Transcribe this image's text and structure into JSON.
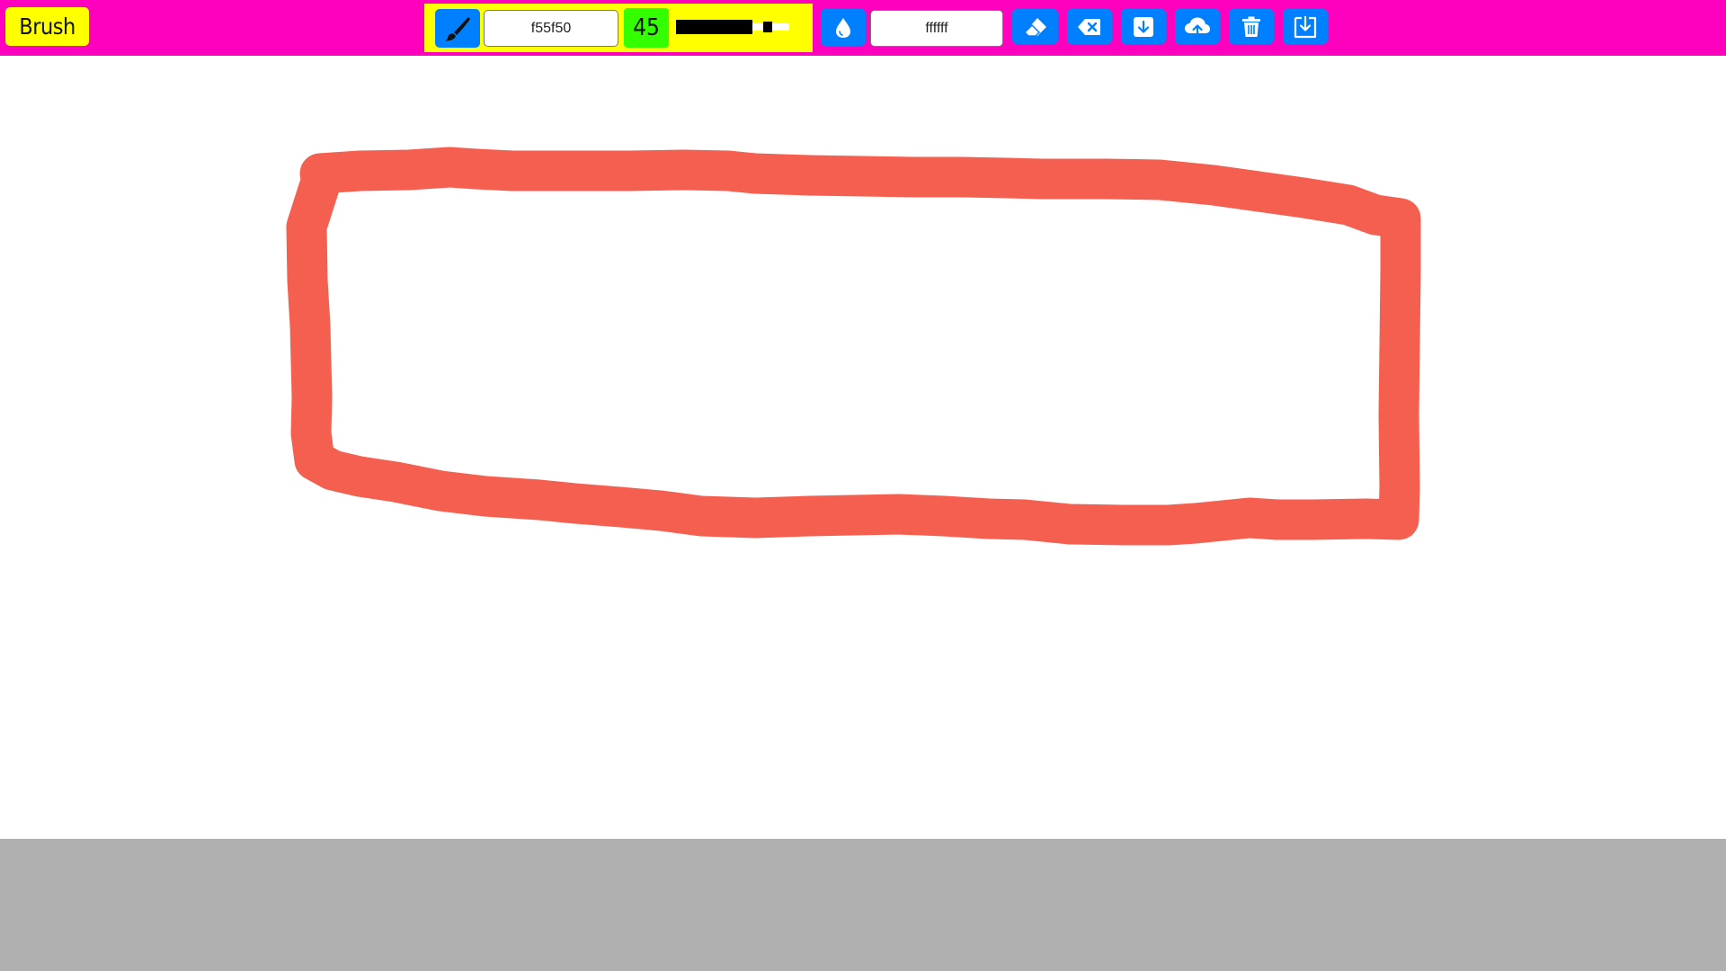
{
  "toolbar": {
    "active_tool_label": "Brush",
    "brush_color": "f55f50",
    "brush_size": "45",
    "brush_size_fraction": 0.82,
    "background_color": "ffffff"
  },
  "icons": {
    "brush_button": "brush-icon",
    "fill_button": "droplet-icon",
    "eraser_button": "eraser-icon",
    "clear_button": "backspace-icon",
    "download_button": "download-icon",
    "upload_button": "cloud-upload-icon",
    "delete_button": "trash-icon",
    "save_button": "save-icon"
  },
  "colors": {
    "topbar": "#ff00bf",
    "tool_label_bg": "#ffff00",
    "button_accent": "#0080ff",
    "size_badge_bg": "#33ff00",
    "stroke": "#f55f50",
    "bottom_area": "#b0b0b0"
  }
}
